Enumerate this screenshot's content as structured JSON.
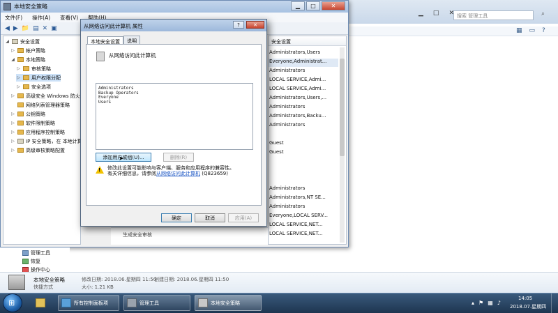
{
  "mmc": {
    "title": "本地安全策略",
    "menu": [
      "文件(F)",
      "操作(A)",
      "查看(V)",
      "帮助(H)"
    ],
    "tree": [
      {
        "label": "安全设置",
        "level": 0
      },
      {
        "label": "帐户策略",
        "level": 1
      },
      {
        "label": "本地策略",
        "level": 1
      },
      {
        "label": "审核策略",
        "level": 2
      },
      {
        "label": "用户权限分配",
        "level": 2
      },
      {
        "label": "安全选项",
        "level": 2
      },
      {
        "label": "高级安全 Windows 防火墙",
        "level": 1
      },
      {
        "label": "网络列表管理器策略",
        "level": 1
      },
      {
        "label": "公钥策略",
        "level": 1
      },
      {
        "label": "软件限制策略",
        "level": 1
      },
      {
        "label": "应用程序控制策略",
        "level": 1
      },
      {
        "label": "IP 安全策略，在 本地计算机",
        "level": 1
      },
      {
        "label": "高级审核策略配置",
        "level": 1
      }
    ],
    "list_header": "安全设置",
    "list_rows": [
      "Administrators,Users",
      "Everyone,Administrat...",
      "Administrators",
      "LOCAL SERVICE,Admi...",
      "LOCAL SERVICE,Admi...",
      "Administrators,Users,...",
      "Administrators",
      "Administrators,Backu...",
      "Administrators",
      "",
      "Guest",
      "Guest",
      "",
      "",
      "Administrators",
      "Administrators,NT SE...",
      "Administrators",
      "Everyone,LOCAL SERV...",
      "LOCAL SERVICE,NET...",
      "LOCAL SERVICE,NET..."
    ],
    "mid_text": "生成安全审核"
  },
  "dialog": {
    "title": "从网络访问此计算机 属性",
    "help": "?",
    "close": "✕",
    "tabs": [
      "本地安全设置",
      "说明"
    ],
    "policy_name": "从网络访问此计算机",
    "members": [
      "Administrators",
      "Backup Operators",
      "Everyone",
      "Users"
    ],
    "add_button": "添加用户或组(U)...",
    "remove_button": "删除(R)",
    "warning_text": "修改此设置可能影响与客户端、服务和应用程序的兼容性。",
    "warning_more": "有关详细信息，请参阅",
    "warning_link": "从网络访问此计算机",
    "warning_kb": "(Q823659)",
    "ok": "确定",
    "cancel": "取消",
    "apply": "应用(A)"
  },
  "explorer": {
    "search_placeholder": "搜索 管理工具",
    "nav_items": [
      {
        "label": "管理工具",
        "icon": "folder-icon"
      },
      {
        "label": "恢复",
        "icon": "recovery-icon"
      },
      {
        "label": "操作中心",
        "icon": "flag-icon"
      }
    ],
    "details": {
      "name": "本地安全策略",
      "type": "快捷方式",
      "modified": "修改日期: 2018.06.星期四 11:50",
      "size": "大小: 1.21 KB",
      "created": "创建日期: 2018.06.星期四 11:50"
    }
  },
  "taskbar": {
    "buttons": [
      "所有控制面板项",
      "管理工具",
      "本地安全策略"
    ],
    "time": "14:05",
    "date": "2018.07.星期四"
  }
}
